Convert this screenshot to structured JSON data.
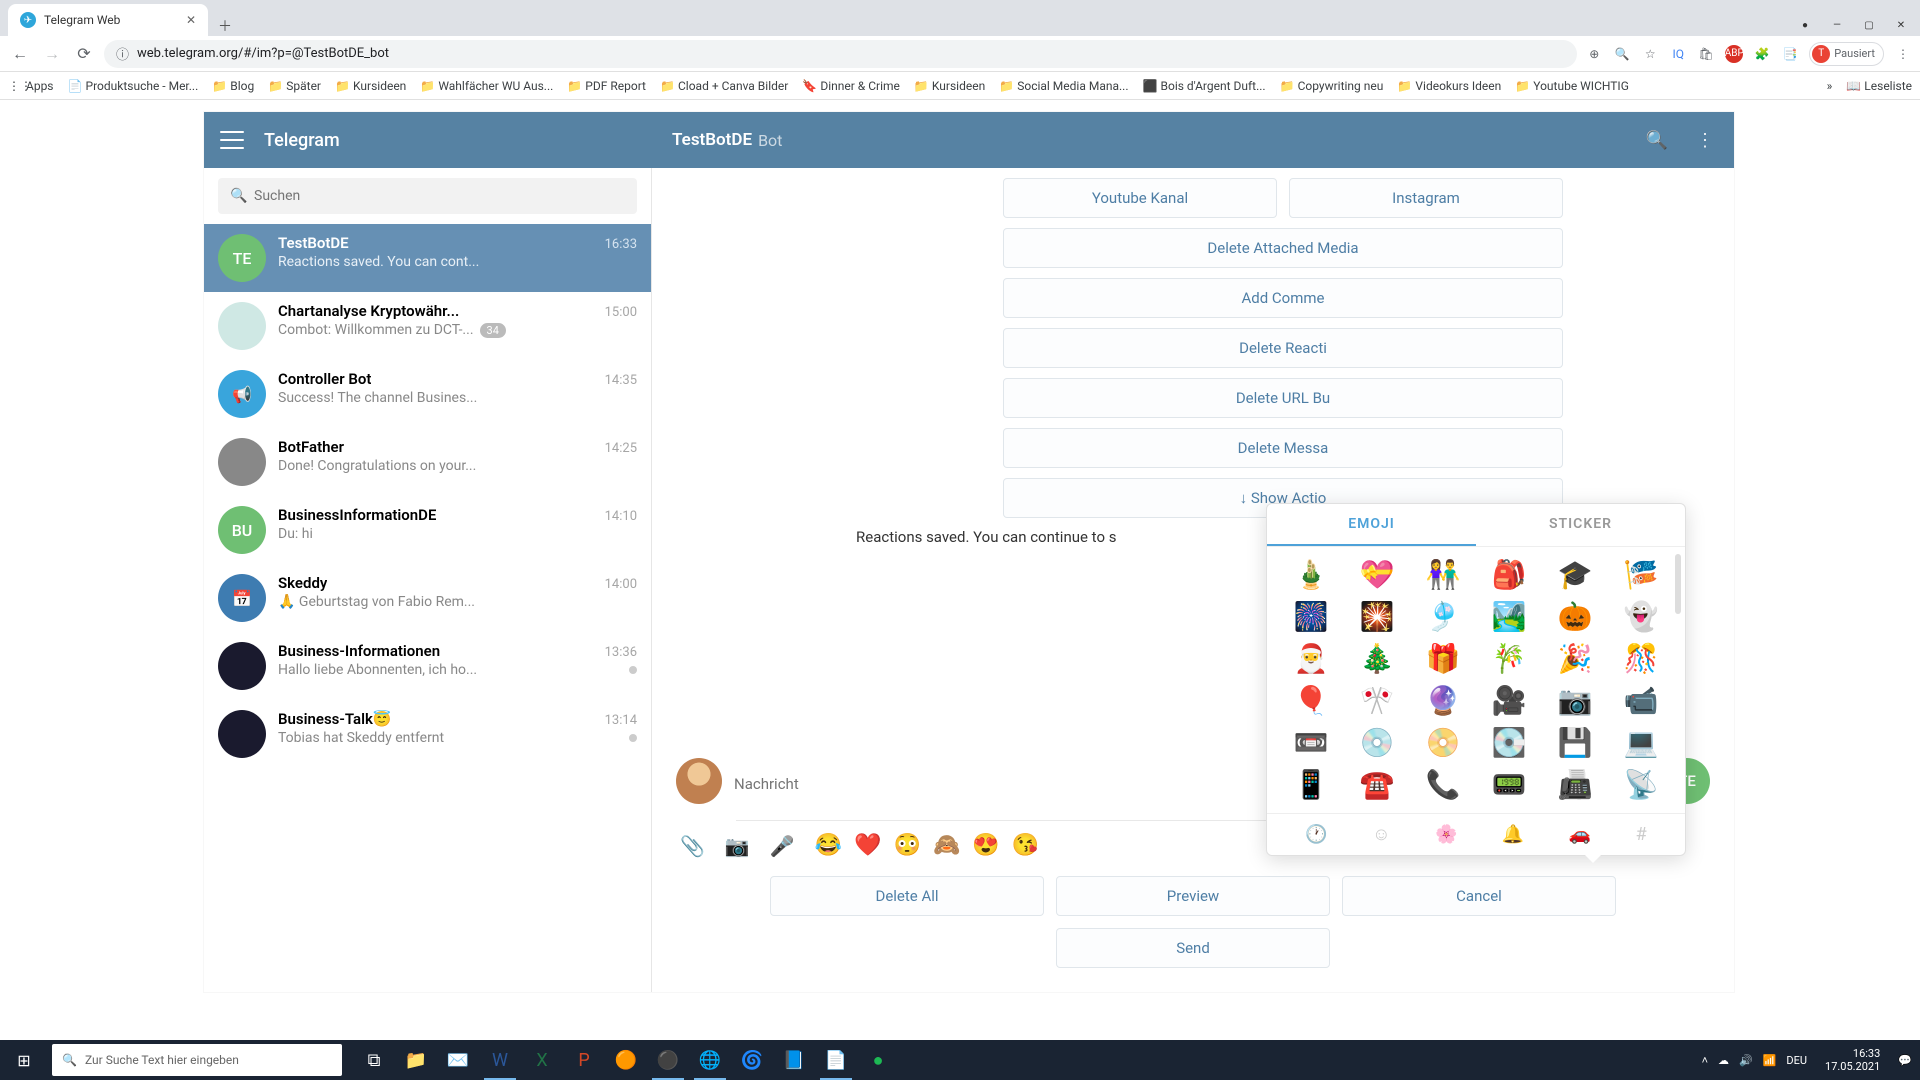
{
  "browser": {
    "tab_title": "Telegram Web",
    "url": "web.telegram.org/#/im?p=@TestBotDE_bot",
    "profile_label": "Pausiert",
    "ext_badge": "ABP"
  },
  "bookmarks": [
    {
      "icon": "⋮⋮",
      "label": "Apps"
    },
    {
      "icon": "📄",
      "label": "Produktsuche - Mer..."
    },
    {
      "icon": "📁",
      "label": "Blog"
    },
    {
      "icon": "📁",
      "label": "Später"
    },
    {
      "icon": "📁",
      "label": "Kursideen"
    },
    {
      "icon": "📁",
      "label": "Wahlfächer WU Aus..."
    },
    {
      "icon": "📁",
      "label": "PDF Report"
    },
    {
      "icon": "📁",
      "label": "Cload + Canva Bilder"
    },
    {
      "icon": "🔖",
      "label": "Dinner & Crime"
    },
    {
      "icon": "📁",
      "label": "Kursideen"
    },
    {
      "icon": "📁",
      "label": "Social Media Mana..."
    },
    {
      "icon": "⬛",
      "label": "Bois d'Argent Duft..."
    },
    {
      "icon": "📁",
      "label": "Copywriting neu"
    },
    {
      "icon": "📁",
      "label": "Videokurs Ideen"
    },
    {
      "icon": "📁",
      "label": "Youtube WICHTIG"
    },
    {
      "icon": "📖",
      "label": "Leseliste"
    }
  ],
  "telegram": {
    "brand": "Telegram",
    "chat_title": "TestBotDE",
    "chat_subtitle": "Bot",
    "search_placeholder": "Suchen",
    "compose_placeholder": "Nachricht",
    "send_label": "SENDEN",
    "chats": [
      {
        "initials": "TE",
        "name": "TestBotDE",
        "time": "16:33",
        "preview": "Reactions saved. You can cont...",
        "active": true,
        "bg": "#6fbf73"
      },
      {
        "initials": "",
        "name": "Chartanalyse Kryptowähr...",
        "time": "15:00",
        "preview": "Combot: Willkommen zu DCT-...",
        "badge": "34",
        "bg": "#cfe8e4",
        "img": true
      },
      {
        "initials": "",
        "name": "Controller Bot",
        "time": "14:35",
        "preview": "Success! The channel Busines...",
        "bg": "#39a5dc",
        "icon": "📢"
      },
      {
        "initials": "",
        "name": "BotFather",
        "time": "14:25",
        "preview": "Done! Congratulations on your...",
        "bg": "#888",
        "img": true
      },
      {
        "initials": "BU",
        "name": "BusinessInformationDE",
        "time": "14:10",
        "preview": "Du: hi",
        "bg": "#6fbf73"
      },
      {
        "initials": "",
        "name": "Skeddy",
        "time": "14:00",
        "preview": "🙏 Geburtstag von Fabio Rem...",
        "bg": "#3e7cb1",
        "icon": "📅"
      },
      {
        "initials": "",
        "name": "Business-Informationen",
        "time": "13:36",
        "preview": "Hallo liebe Abonnenten, ich ho...",
        "bg": "#1a1a2e",
        "img": true,
        "dot": true
      },
      {
        "initials": "",
        "name": "Business-Talk😇",
        "time": "13:14",
        "preview": "Tobias hat Skeddy entfernt",
        "bg": "#1a1a2e",
        "img": true,
        "dot": true
      }
    ],
    "bot_buttons_top": [
      [
        "Youtube Kanal",
        "Instagram"
      ],
      [
        "Delete Attached Media"
      ],
      [
        "Add Comme"
      ],
      [
        "Delete Reacti"
      ],
      [
        "Delete URL Bu"
      ],
      [
        "Delete Messa"
      ],
      [
        "↓ Show Actio"
      ]
    ],
    "status_message": "Reactions saved. You can continue to s",
    "quick_emojis": [
      "😂",
      "❤️",
      "😳",
      "🙈",
      "😍",
      "😘"
    ],
    "bot_buttons_bottom": [
      [
        "Delete All",
        "Preview"
      ],
      [
        "Cancel",
        "Send"
      ]
    ],
    "bot_avatar_initials": "TE"
  },
  "emoji_panel": {
    "tabs": [
      "EMOJI",
      "STICKER"
    ],
    "active_tab": 0,
    "grid": [
      "🎍",
      "💝",
      "👫",
      "🎒",
      "🎓",
      "🎏",
      "🎆",
      "🎇",
      "🎐",
      "🏞️",
      "🎃",
      "👻",
      "🎅",
      "🎄",
      "🎁",
      "🎋",
      "🎉",
      "🎊",
      "🎈",
      "🎌",
      "🔮",
      "🎥",
      "📷",
      "📹",
      "📼",
      "💿",
      "📀",
      "💽",
      "💾",
      "💻",
      "📱",
      "☎️",
      "📞",
      "📟",
      "📠",
      "📡"
    ],
    "categories": [
      "🕐",
      "☺",
      "🌸",
      "🔔",
      "🚗",
      "#"
    ]
  },
  "taskbar": {
    "search_placeholder": "Zur Suche Text hier eingeben",
    "lang": "DEU",
    "time": "16:33",
    "date": "17.05.2021"
  }
}
